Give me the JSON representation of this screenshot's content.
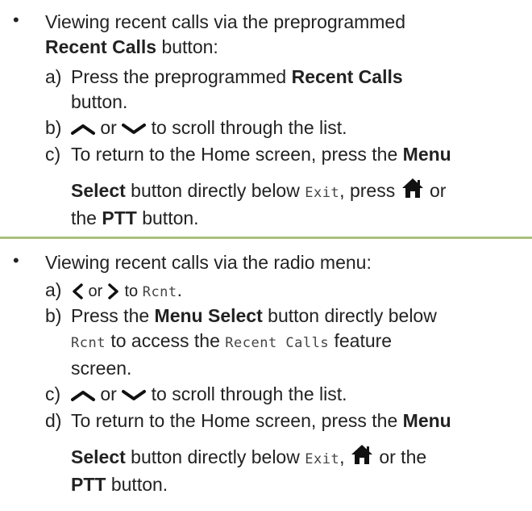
{
  "section1": {
    "bullet": "•",
    "intro_line1": "Viewing recent calls via the preprogrammed",
    "intro_bold": "Recent Calls",
    "intro_rest": " button:",
    "steps": {
      "a": {
        "label": "a)",
        "pre": "Press the preprogrammed ",
        "bold": "Recent Calls",
        "post": "button."
      },
      "b": {
        "label": "b)",
        "mid": " or ",
        "post": " to scroll through the list."
      },
      "c": {
        "label": "c)",
        "line1_pre": "To return to the Home screen, press the ",
        "line1_bold": "Menu",
        "line2_bold": "Select",
        "line2_mid": " button directly below ",
        "line2_mono": "Exit",
        "line2_post": ", press ",
        "line2_end": " or",
        "line3_pre": "the ",
        "line3_bold": "PTT",
        "line3_post": " button."
      }
    }
  },
  "section2": {
    "bullet": "•",
    "intro": "Viewing recent calls via the radio menu:",
    "steps": {
      "a": {
        "label": "a)",
        "mid": " or ",
        "post_pre": " to ",
        "mono": "Rcnt",
        "post": "."
      },
      "b": {
        "label": "b)",
        "line1_pre": "Press the ",
        "line1_bold": "Menu Select",
        "line1_post": " button directly below",
        "line2_mono1": "Rcnt",
        "line2_mid": " to access the ",
        "line2_mono2": "Recent Calls",
        "line2_post": " feature",
        "line3": "screen."
      },
      "c": {
        "label": "c)",
        "mid": " or ",
        "post": " to scroll through the list."
      },
      "d": {
        "label": "d)",
        "line1_pre": "To return to the Home screen, press the ",
        "line1_bold": "Menu",
        "line2_bold": "Select",
        "line2_mid": " button directly below ",
        "line2_mono": "Exit",
        "line2_sep": ", ",
        "line2_post": " or the",
        "line3_bold": "PTT",
        "line3_post": " button."
      }
    }
  },
  "colors": {
    "divider": "#a8c07a",
    "text": "#222222"
  },
  "icons": [
    "up-arrow-icon",
    "down-arrow-icon",
    "home-icon",
    "left-arrow-icon",
    "right-arrow-icon"
  ]
}
